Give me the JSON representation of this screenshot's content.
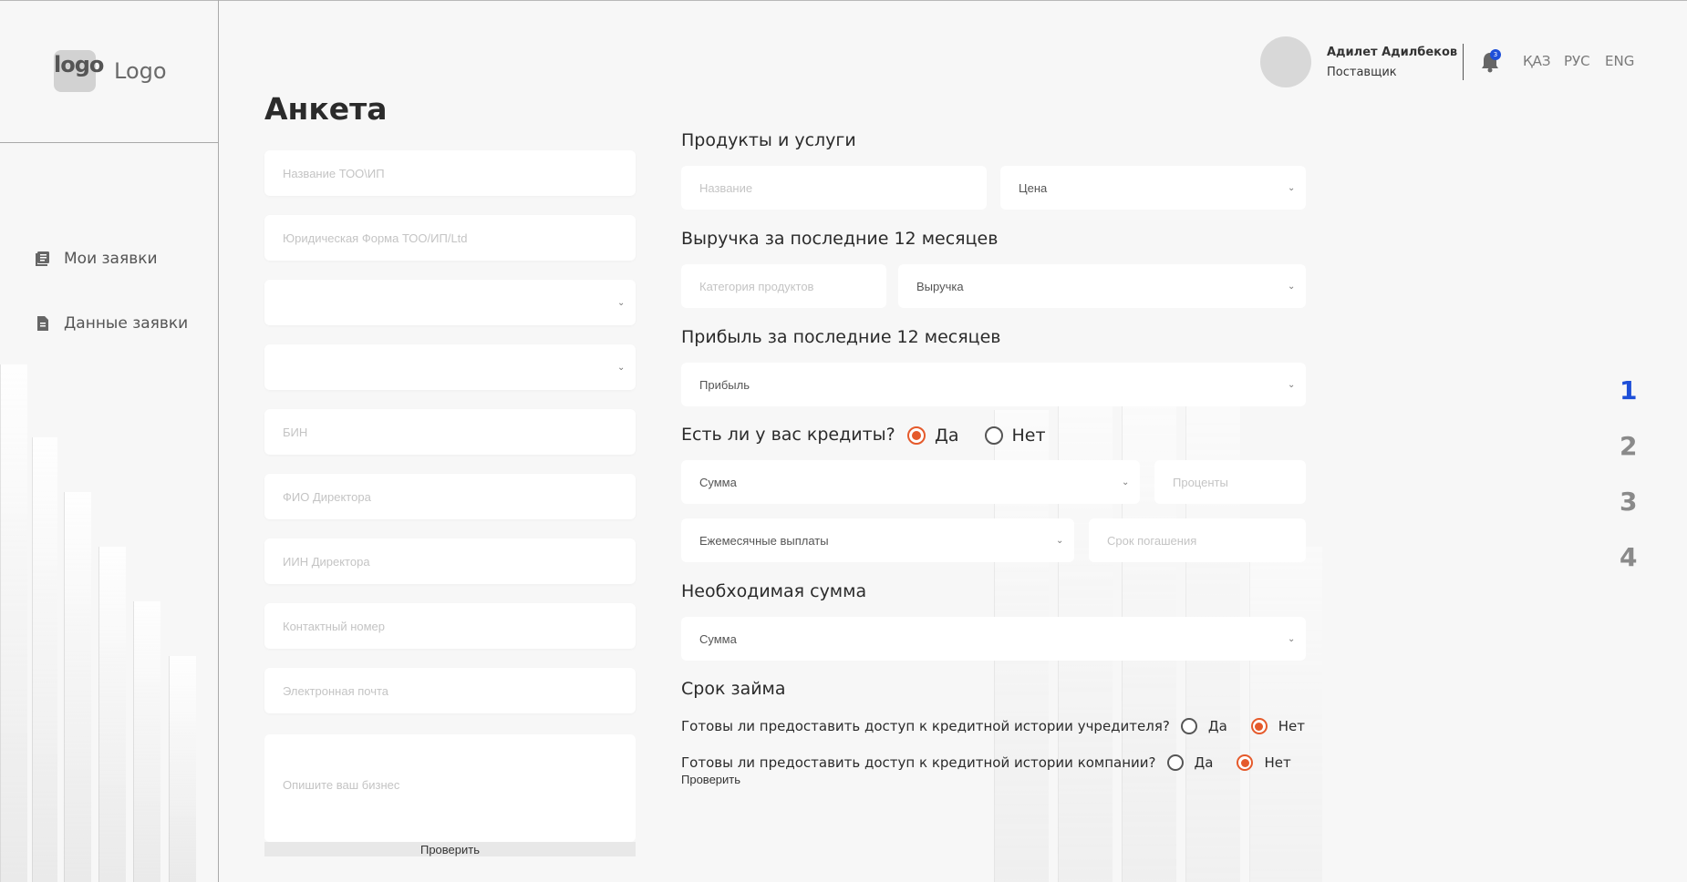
{
  "sidebar": {
    "logo_mark": "logo",
    "logo_text": "Logo",
    "items": [
      {
        "label": "Мои заявки",
        "icon": "list-icon"
      },
      {
        "label": "Данные заявки",
        "icon": "document-icon"
      }
    ]
  },
  "header": {
    "user_name": "Адилет Адилбеков",
    "user_role": "Поставщик",
    "notifications_count": "3",
    "languages": [
      "ҚАЗ",
      "РУС",
      "ENG"
    ]
  },
  "page_title": "Анкета",
  "left_form": {
    "company_name_placeholder": "Название ТОО\\ИП",
    "legal_form_placeholder": "Юридическая Форма ТОО/ИП/Ltd",
    "select1_value": "",
    "select2_value": "",
    "bin_placeholder": "БИН",
    "director_name_placeholder": "ФИО Директора",
    "director_iin_placeholder": "ИИН Директора",
    "phone_placeholder": "Контактный номер",
    "email_placeholder": "Электронная почта",
    "description_placeholder": "Опишите ваш бизнес",
    "check_button": "Проверить"
  },
  "right_form": {
    "products_title": "Продукты и услуги",
    "product_name_placeholder": "Название",
    "price_select": "Цена",
    "revenue_title": "Выручка за последние 12 месяцев",
    "product_category_placeholder": "Категория продуктов",
    "revenue_select": "Выручка",
    "profit_title": "Прибыль за последние 12 месяцев",
    "profit_select": "Прибыль",
    "credits_title": "Есть ли у вас кредиты?",
    "yes": "Да",
    "no": "Нет",
    "credit_amount_select": "Сумма",
    "interest_placeholder": "Проценты",
    "monthly_payments_select": "Ежемесячные выплаты",
    "repayment_term_placeholder": "Срок погашения",
    "required_amount_title": "Необходимая сумма",
    "required_amount_select": "Сумма",
    "loan_term_title": "Срок займа",
    "founder_history_question": "Готовы ли предоставить доступ к кредитной истории учредителя?",
    "company_history_question": "Готовы ли предоставить доступ к кредитной истории компании?",
    "check_button": "Проверить"
  },
  "steps": [
    "1",
    "2",
    "3",
    "4"
  ],
  "colors": {
    "accent_radio": "#e55a2b",
    "active_step": "#1e4fd8",
    "badge": "#1e4fd8"
  }
}
